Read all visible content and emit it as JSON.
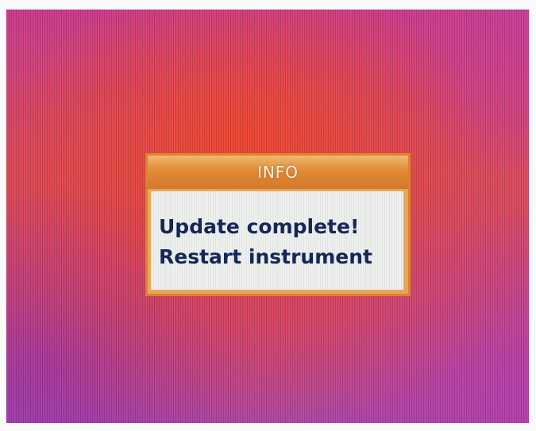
{
  "dialog": {
    "title": "INFO",
    "message_line1": "Update complete!",
    "message_line2": "Restart instrument"
  },
  "colors": {
    "header_orange": "#e08a35",
    "body_background": "#eef0ee",
    "message_text": "#14285a",
    "screen_red": "#e23e3e",
    "screen_purple": "#a845a8"
  }
}
